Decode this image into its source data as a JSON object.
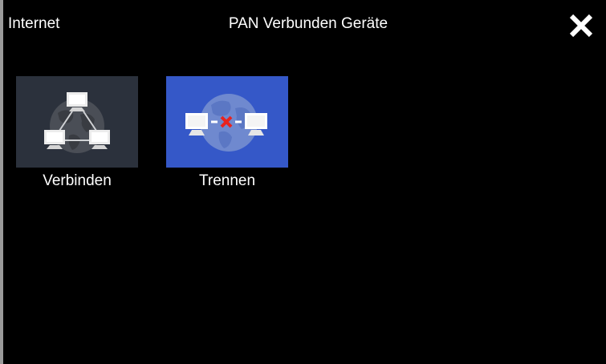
{
  "header": {
    "left_label": "Internet",
    "title": "PAN Verbunden Geräte",
    "close_icon": "close-x-icon"
  },
  "tiles": [
    {
      "label": "Verbinden",
      "icon": "network-connect-icon",
      "background": "#2b313c",
      "selected": false
    },
    {
      "label": "Trennen",
      "icon": "network-disconnect-icon",
      "background": "#3558c8",
      "selected": true
    }
  ],
  "colors": {
    "background": "#000000",
    "text": "#ffffff",
    "selected_tile": "#3558c8",
    "tile": "#2b313c",
    "disconnect_mark": "#e8231f"
  }
}
